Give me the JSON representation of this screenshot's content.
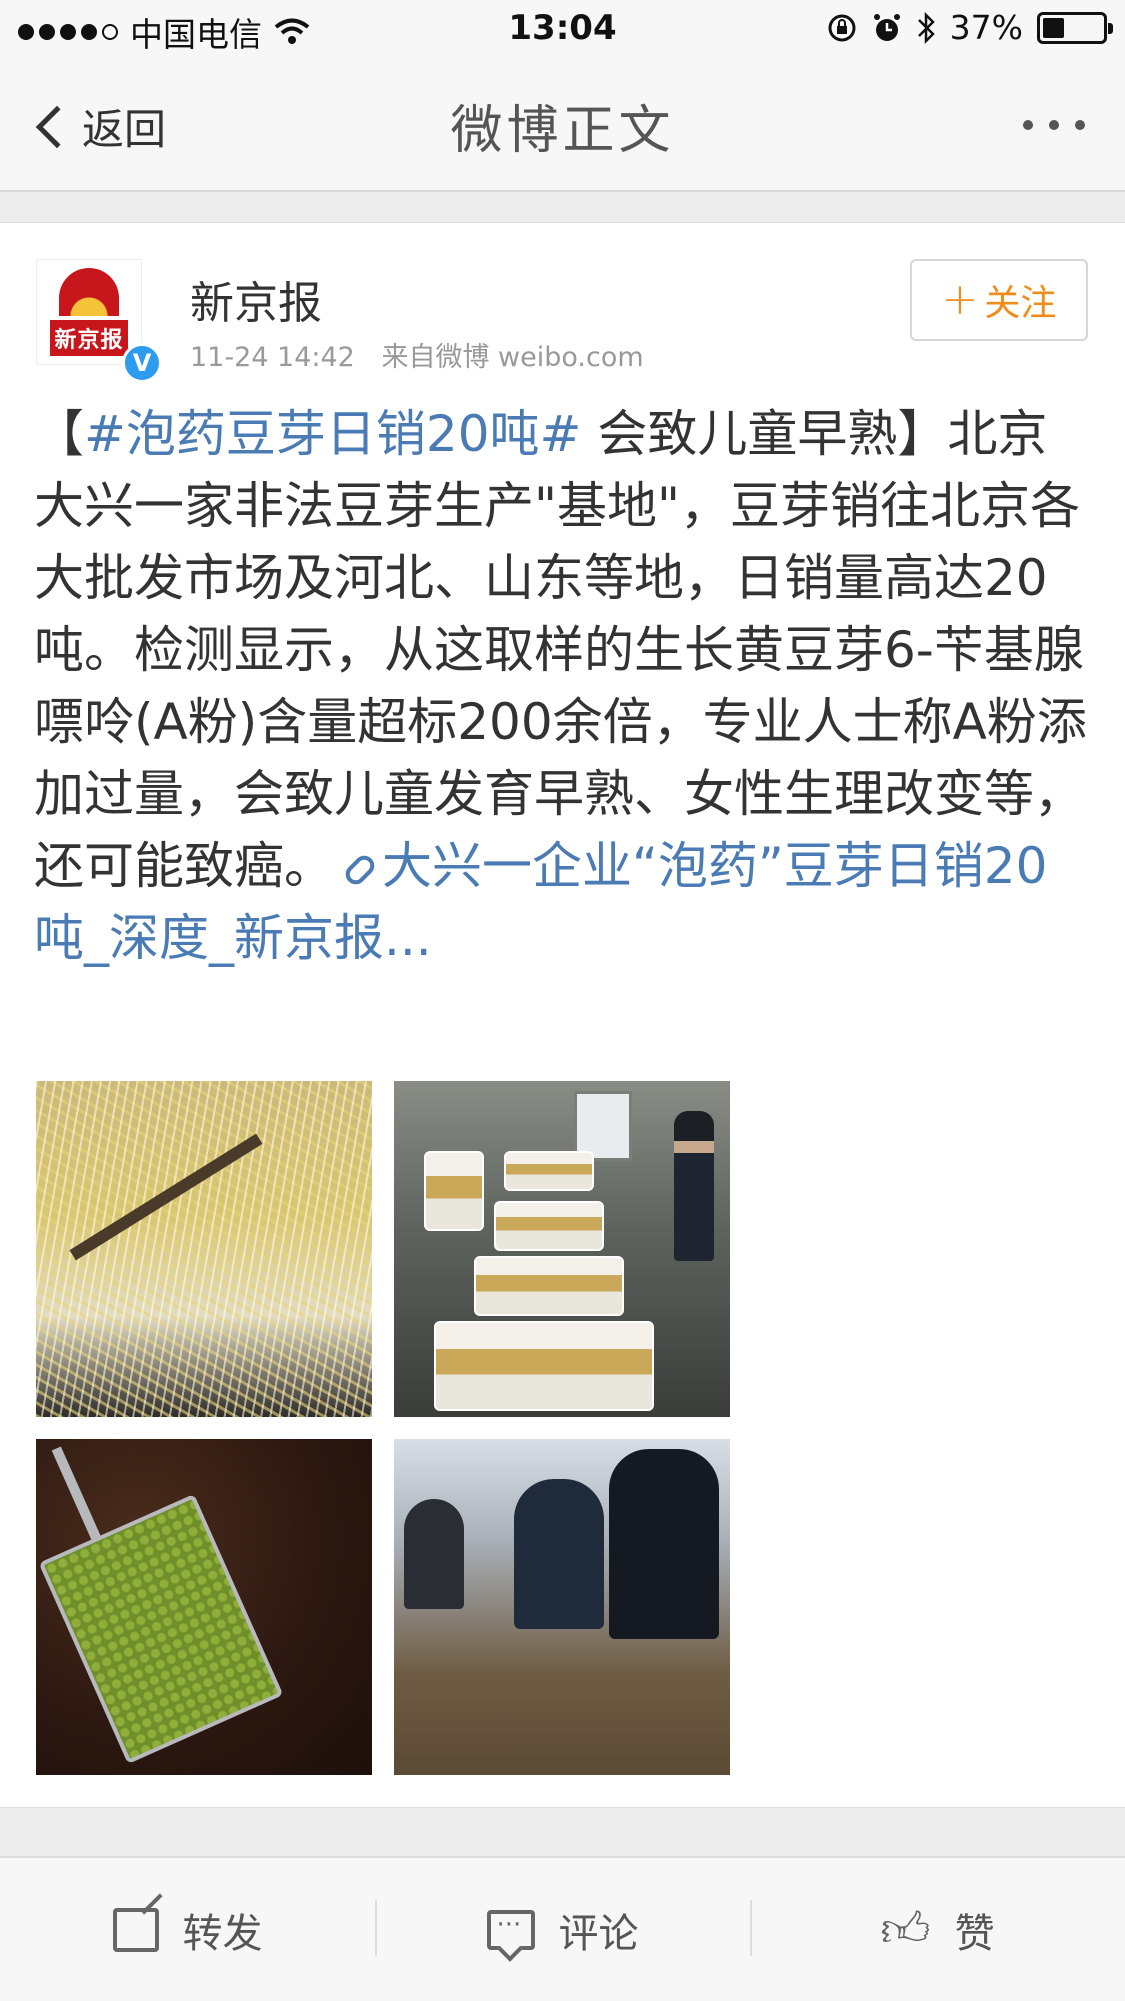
{
  "status_bar": {
    "carrier": "中国电信",
    "time": "13:04",
    "battery_percent": "37%",
    "battery_level": 0.37,
    "signal_bars_filled": 4,
    "signal_bars_total": 5
  },
  "nav": {
    "back_label": "返回",
    "title": "微博正文"
  },
  "post": {
    "author": "新京报",
    "avatar_text": "新京报",
    "verified_mark": "V",
    "date": "11-24 14:42",
    "source": "来自微博 weibo.com",
    "follow_label": "关注",
    "text_open_bracket": "【",
    "hashtag": "#泡药豆芽日销20吨#",
    "headline_rest": " 会致儿童早熟】",
    "body": "北京大兴一家非法豆芽生产\"基地\"，豆芽销往北京各大批发市场及河北、山东等地，日销量高达20吨。检测显示，从这取样的生长黄豆芽6-苄基腺嘌呤(A粉)含量超标200余倍，专业人士称A粉添加过量，会致儿童发育早熟、女性生理改变等，还可能致癌。",
    "link_text": "大兴一企业“泡药”豆芽日销20吨_深度_新京报..."
  },
  "toolbar": {
    "repost_label": "转发",
    "comment_label": "评论",
    "like_label": "赞"
  },
  "colors": {
    "link_blue": "#4a7bb4",
    "follow_orange": "#f08c1b",
    "verified_blue": "#2d9bf0",
    "brand_red": "#c8161d"
  }
}
